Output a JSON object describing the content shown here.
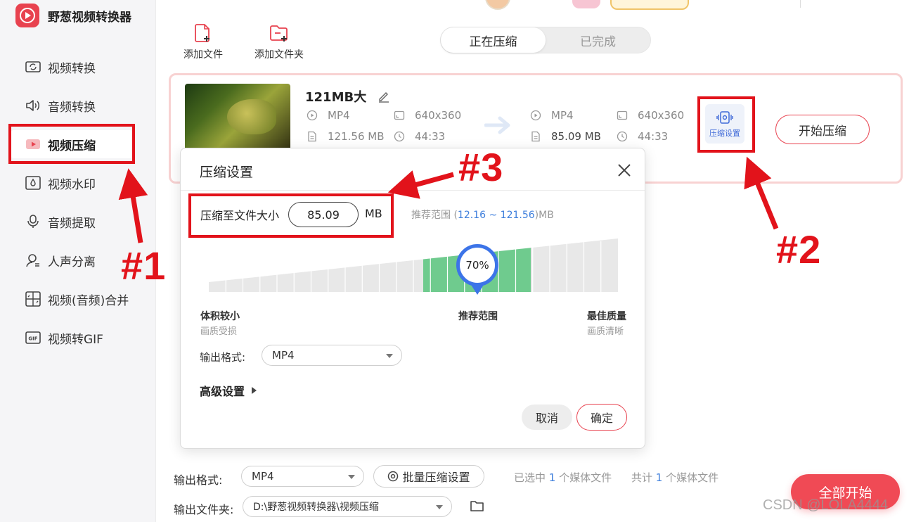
{
  "app": {
    "name": "野葱视频转换器"
  },
  "sidebar": {
    "items": [
      {
        "label": "视频转换",
        "icon": "video-convert-icon"
      },
      {
        "label": "音频转换",
        "icon": "audio-convert-icon"
      },
      {
        "label": "视频压缩",
        "icon": "video-compress-icon",
        "active": true
      },
      {
        "label": "视频水印",
        "icon": "watermark-icon"
      },
      {
        "label": "音频提取",
        "icon": "audio-extract-icon"
      },
      {
        "label": "人声分离",
        "icon": "voice-separate-icon"
      },
      {
        "label": "视频(音频)合并",
        "icon": "merge-icon"
      },
      {
        "label": "视频转GIF",
        "icon": "gif-icon"
      }
    ]
  },
  "toolbar": {
    "add_file": "添加文件",
    "add_folder": "添加文件夹"
  },
  "tabs": [
    {
      "label": "正在压缩",
      "active": true
    },
    {
      "label": "已完成",
      "active": false
    }
  ],
  "file": {
    "name": "121MB大",
    "source": {
      "format": "MP4",
      "resolution": "640x360",
      "size": "121.56 MB",
      "duration": "44:33"
    },
    "target": {
      "format": "MP4",
      "resolution": "640x360",
      "size": "85.09 MB",
      "duration": "44:33"
    },
    "settings_label": "压缩设置",
    "start_label": "开始压缩"
  },
  "modal": {
    "title": "压缩设置",
    "size_label": "压缩至文件大小",
    "size_value": "85.09",
    "size_unit": "MB",
    "range_prefix": "推荐范围 (",
    "range_low": "12.16",
    "range_sep": " ~ ",
    "range_high": "121.56",
    "range_suffix": ")MB",
    "slider_percent": 70,
    "slider_label": "70%",
    "left_title": "体积较小",
    "left_sub": "画质受损",
    "mid_title": "推荐范围",
    "right_title": "最佳质量",
    "right_sub": "画质清晰",
    "format_label": "输出格式:",
    "format_value": "MP4",
    "advanced_label": "高级设置",
    "cancel_label": "取消",
    "ok_label": "确定"
  },
  "bottom": {
    "format_label": "输出格式:",
    "format_value": "MP4",
    "batch_label": "批量压缩设置",
    "selected_prefix": "已选中",
    "selected_count": "1",
    "selected_suffix": "个媒体文件",
    "total_prefix": "共计",
    "total_count": "1",
    "total_suffix": "个媒体文件",
    "folder_label": "输出文件夹:",
    "folder_value": "D:\\野葱视频转换器\\视频压缩",
    "start_all_label": "全部开始"
  },
  "annotations": {
    "a1": "#1",
    "a2": "#2",
    "a3": "#3"
  },
  "watermark": "CSDN @LOLA4444",
  "colors": {
    "accent": "#e8424f",
    "annotation": "#e2131b",
    "slider_fill": "#6fcb8e",
    "bubble": "#3c74e8",
    "link_blue": "#3f7fdc"
  }
}
